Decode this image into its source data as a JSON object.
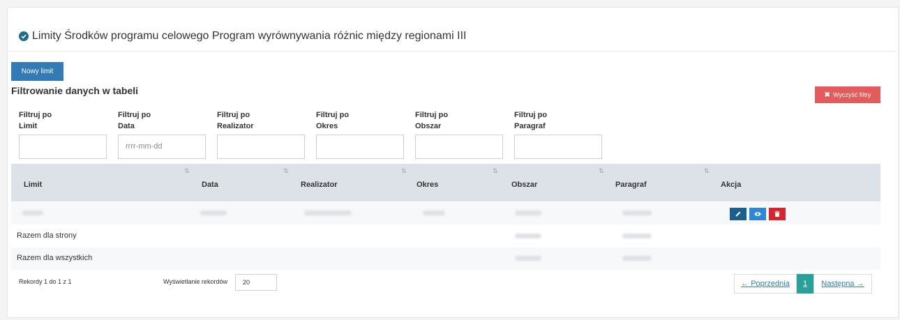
{
  "panel": {
    "title": "Limity Środków programu celowego Program wyrównywania różnic między regionami III"
  },
  "toolbar": {
    "new_label": "Nowy limit",
    "clear_label": "Wyczyść filtry"
  },
  "filters": {
    "heading": "Filtrowanie danych w tabeli",
    "items": [
      {
        "label1": "Filtruj po",
        "label2": "Limit",
        "value": "",
        "placeholder": ""
      },
      {
        "label1": "Filtruj po",
        "label2": "Data",
        "value": "",
        "placeholder": "rrrr-mm-dd"
      },
      {
        "label1": "Filtruj po",
        "label2": "Realizator",
        "value": "",
        "placeholder": ""
      },
      {
        "label1": "Filtruj po",
        "label2": "Okres",
        "value": "",
        "placeholder": ""
      },
      {
        "label1": "Filtruj po",
        "label2": "Obszar",
        "value": "",
        "placeholder": ""
      },
      {
        "label1": "Filtruj po",
        "label2": "Paragraf",
        "value": "",
        "placeholder": ""
      }
    ]
  },
  "table": {
    "columns": [
      "Limit",
      "Data",
      "Realizator",
      "Okres",
      "Obszar",
      "Paragraf",
      "Akcja"
    ],
    "sort_icon": "⇅",
    "summary_rows": [
      "Razem dla strony",
      "Razem dla wszystkich"
    ]
  },
  "footer": {
    "records_info": "Rekordy 1 do 1 z 1",
    "records_label": "Wyświetlanie rekordów",
    "records_value": "20"
  },
  "pagination": {
    "prev": "← Poprzednia",
    "current": "1",
    "next": "Następna →"
  },
  "icons": [
    "check-circle-icon",
    "times-icon",
    "sort-icon",
    "pencil-icon",
    "eye-icon",
    "trash-icon"
  ],
  "colors": {
    "primary": "#337ab7",
    "danger": "#e35b5b",
    "header_bg": "#dde2e8",
    "page_current": "#2aa198"
  }
}
